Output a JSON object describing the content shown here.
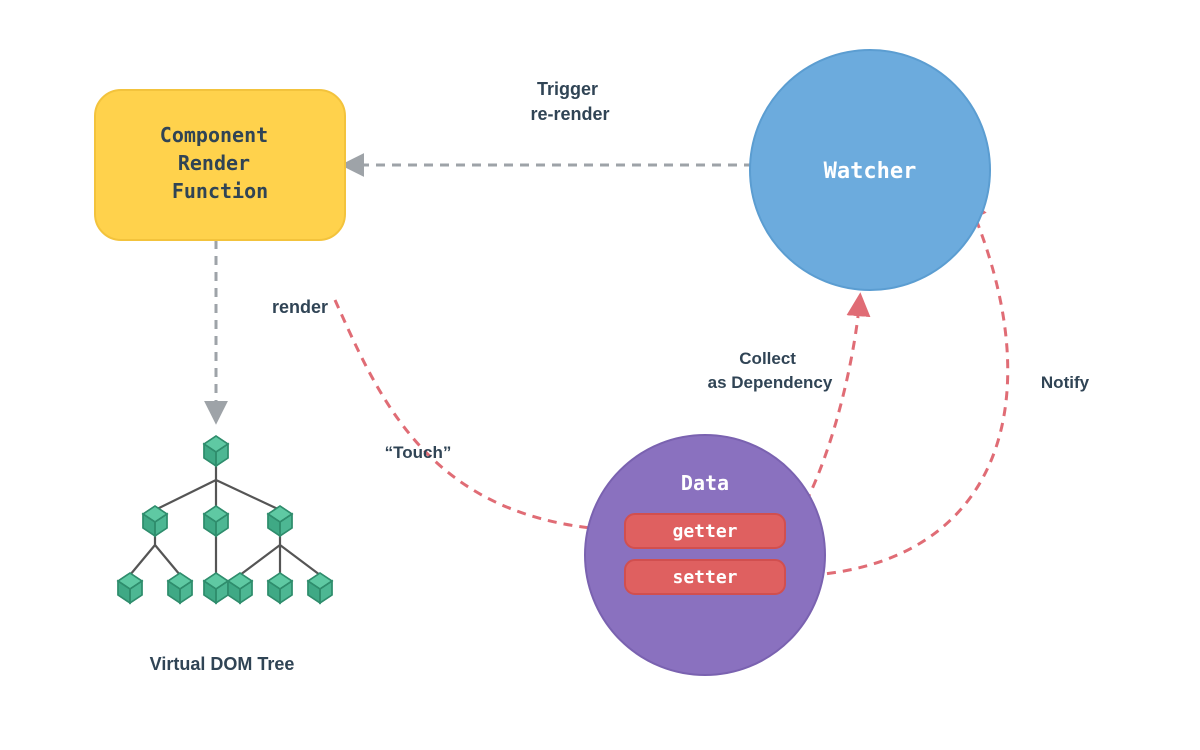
{
  "nodes": {
    "component_render_function": {
      "lines": [
        "Component",
        "Render",
        "Function"
      ],
      "color": "#FFD24C",
      "stroke": "#F3C33C"
    },
    "watcher": {
      "label": "Watcher",
      "color": "#6CABDD",
      "stroke": "#5B9DD1"
    },
    "data": {
      "label": "Data",
      "getter": "getter",
      "setter": "setter",
      "color": "#8A71BF",
      "stroke": "#7A62B0",
      "pill_color": "#DF6060",
      "pill_stroke": "#D14F4F"
    },
    "virtual_dom_tree": {
      "label": "Virtual DOM Tree",
      "cube_fill": "#4DB793",
      "cube_stroke": "#2F8D6D"
    }
  },
  "edges": {
    "trigger_rerender": {
      "lines": [
        "Trigger",
        "re-render"
      ]
    },
    "render": {
      "label": "render"
    },
    "touch": {
      "label": "“Touch”"
    },
    "collect_dependency": {
      "lines": [
        "Collect",
        "as Dependency"
      ]
    },
    "notify": {
      "label": "Notify"
    }
  },
  "colors": {
    "grey_arrow": "#9EA3A8",
    "red_arrow": "#E06C75",
    "text_dark": "#304455"
  }
}
